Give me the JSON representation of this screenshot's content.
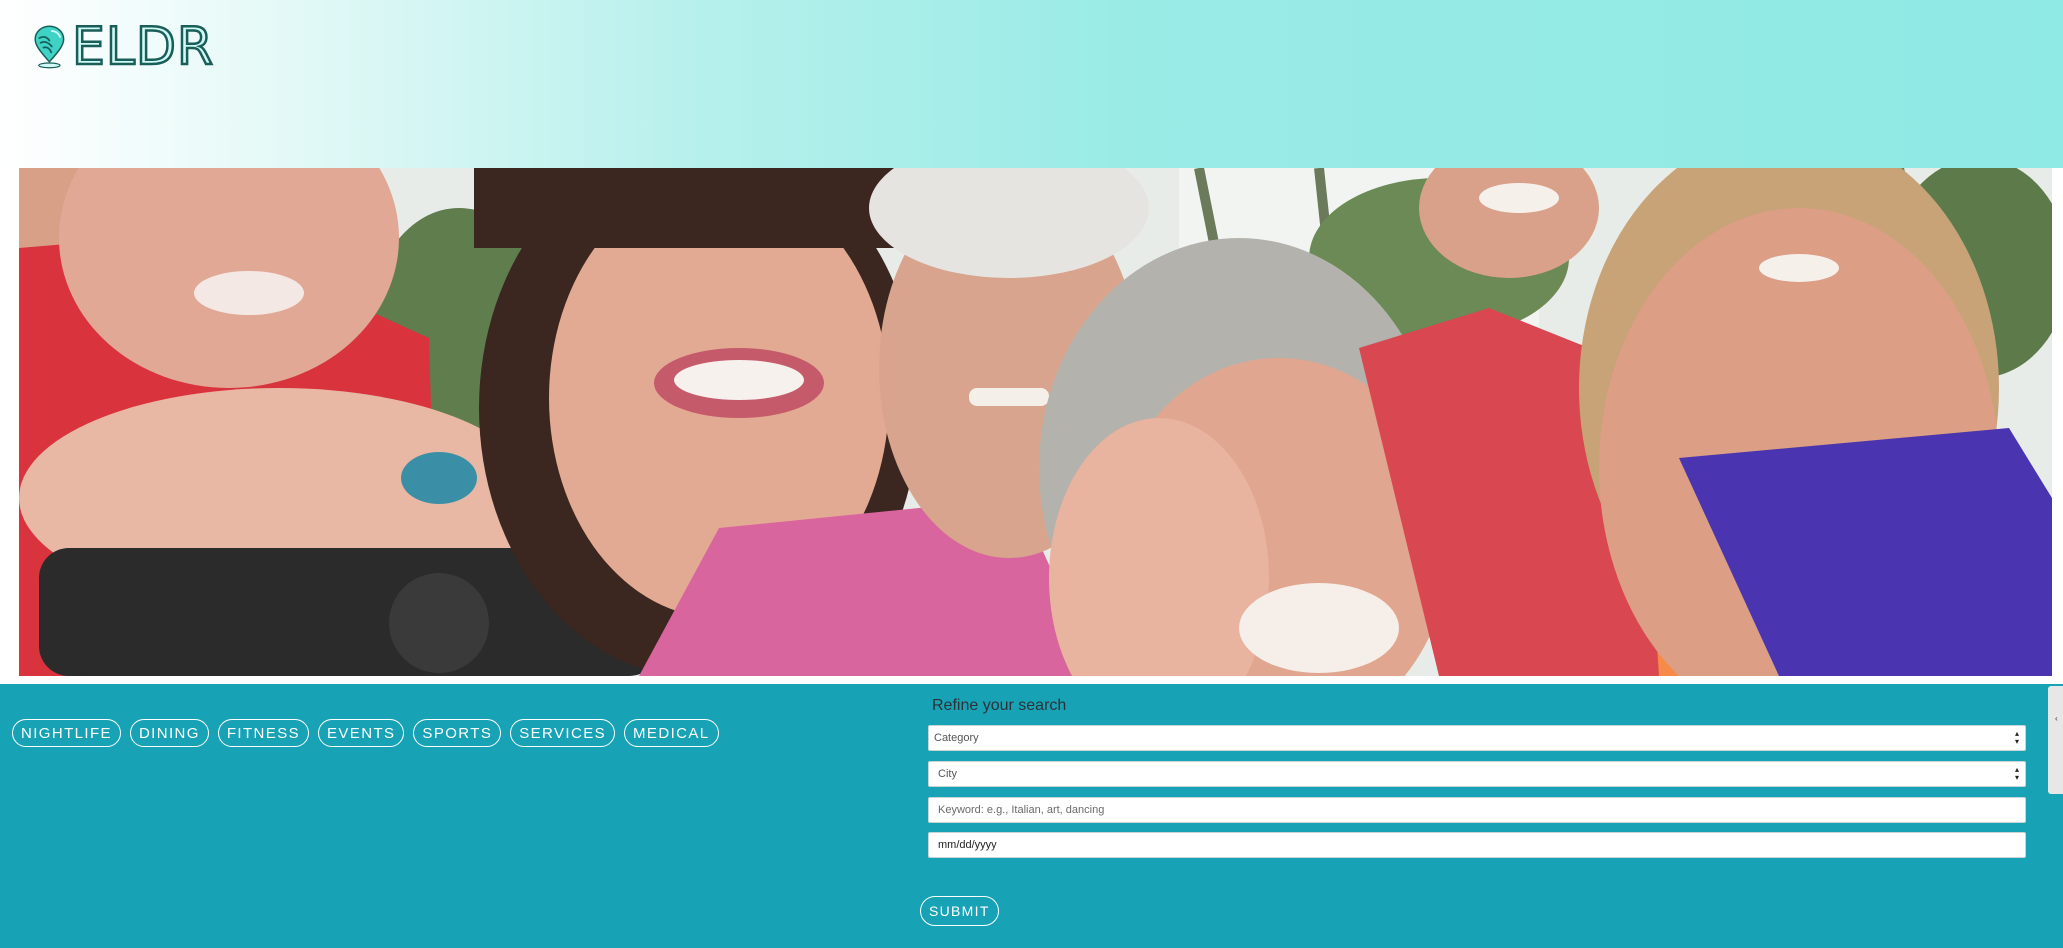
{
  "brand": {
    "name": "ELDR",
    "logo_icon": "location-pin-icon"
  },
  "hero": {
    "image_desc_icon": "hero-photo"
  },
  "categories": [
    {
      "label": "NIGHTLIFE"
    },
    {
      "label": "DINING"
    },
    {
      "label": "FITNESS"
    },
    {
      "label": "EVENTS"
    },
    {
      "label": "SPORTS"
    },
    {
      "label": "SERVICES"
    },
    {
      "label": "MEDICAL"
    }
  ],
  "search": {
    "title": "Refine your search",
    "category_value": "Category",
    "city_value": "City",
    "keyword_placeholder": "Keyword: e.g., Italian, art, dancing",
    "date_placeholder": "mm/dd/yyyy",
    "submit_label": "SUBMIT"
  },
  "colors": {
    "band": "#18a2b6",
    "header_accent": "#8fe9e4",
    "logo_stroke": "#1a5e5a"
  }
}
